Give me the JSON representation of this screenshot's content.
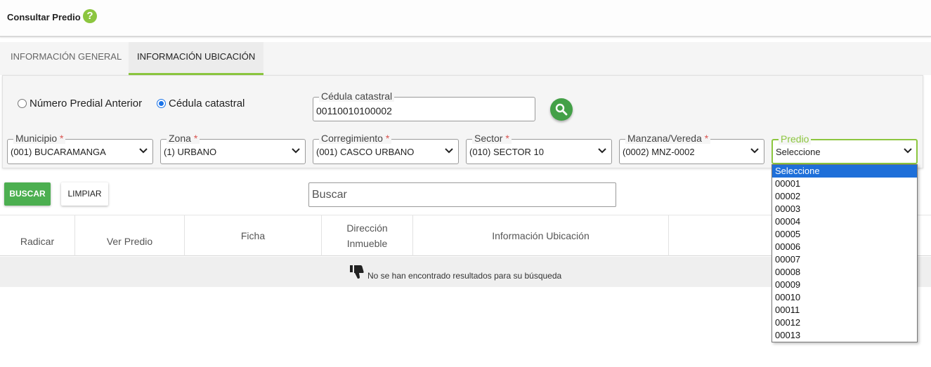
{
  "header": {
    "title": "Consultar Predio",
    "help_icon": "?"
  },
  "tabs": [
    {
      "label": "INFORMACIÓN GENERAL",
      "active": false
    },
    {
      "label": "INFORMACIÓN UBICACIÓN",
      "active": true
    }
  ],
  "search_mode": {
    "options": [
      "Número Predial Anterior",
      "Cédula catastral"
    ],
    "selected": "Cédula catastral"
  },
  "cedula": {
    "label": "Cédula catastral",
    "value": "00110010100002"
  },
  "filters": {
    "municipio": {
      "label": "Municipio",
      "required": "*",
      "value": "(001) BUCARAMANGA"
    },
    "zona": {
      "label": "Zona",
      "required": "*",
      "value": "(1) URBANO"
    },
    "corregimiento": {
      "label": "Corregimiento",
      "required": "*",
      "value": "(001) CASCO URBANO"
    },
    "sector": {
      "label": "Sector",
      "required": "*",
      "value": "(010) SECTOR 10"
    },
    "manzana": {
      "label": "Manzana/Vereda",
      "required": "*",
      "value": "(0002) MNZ-0002"
    },
    "predio": {
      "label": "Predio",
      "value": "Seleccione"
    }
  },
  "actions": {
    "buscar": "BUSCAR",
    "limpiar": "LIMPIAR"
  },
  "table_search": {
    "placeholder": "Buscar"
  },
  "table": {
    "columns": [
      "Radicar",
      "Ver Predio",
      "Ficha",
      "Dirección Inmueble",
      "Información Ubicación"
    ],
    "empty_message": "No se han encontrado resultados para su búsqueda"
  },
  "predio_dropdown": {
    "options": [
      "Seleccione",
      "00001",
      "00002",
      "00003",
      "00004",
      "00005",
      "00006",
      "00007",
      "00008",
      "00009",
      "00010",
      "00011",
      "00012",
      "00013"
    ],
    "highlighted": "Seleccione"
  },
  "colors": {
    "accent": "#8cc63f",
    "primary_button": "#4caf50",
    "selection": "#1e6fd9"
  }
}
